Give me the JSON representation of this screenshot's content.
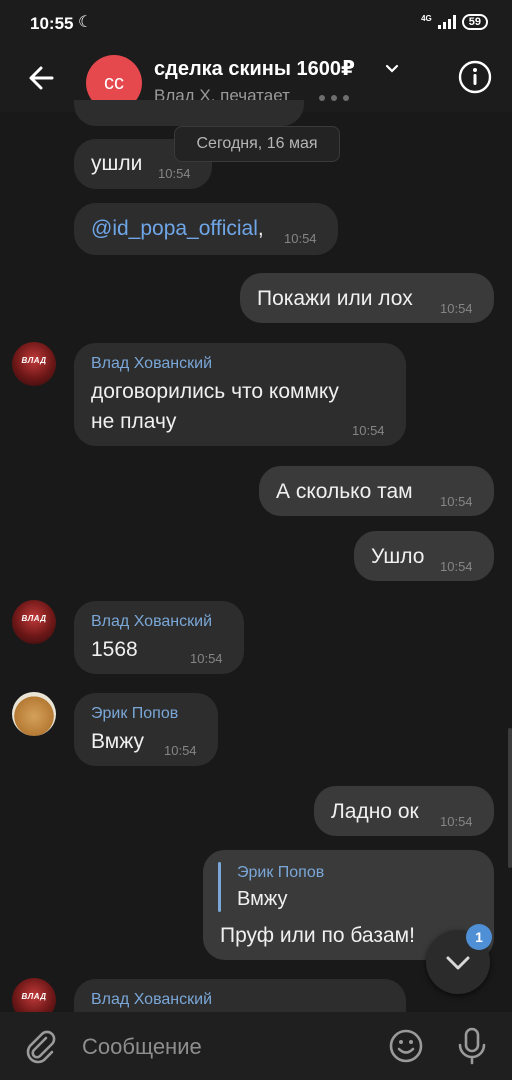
{
  "status_bar": {
    "time": "10:55",
    "network": "4G",
    "battery": "59"
  },
  "header": {
    "avatar_initials": "сс",
    "title": "сделка скины 1600₽",
    "subtitle": "Влад Х. печатает"
  },
  "date_separator": "Сегодня, 16 мая",
  "messages": [
    {
      "text": "ушли",
      "time": "10:54"
    },
    {
      "text": "@id_popa_official",
      "suffix": ",",
      "time": "10:54"
    },
    {
      "text": "Покажи или лох",
      "time": "10:54"
    },
    {
      "sender": "Влад Хованский",
      "line1": "договорились что коммку",
      "line2": "не плачу",
      "time": "10:54"
    },
    {
      "text": "А сколько там",
      "time": "10:54"
    },
    {
      "text": "Ушло",
      "time": "10:54"
    },
    {
      "sender": "Влад Хованский",
      "text": "1568",
      "time": "10:54"
    },
    {
      "sender": "Эрик Попов",
      "text": "Вмжу",
      "time": "10:54"
    },
    {
      "text": "Ладно ок",
      "time": "10:54"
    },
    {
      "reply_sender": "Эрик Попов",
      "reply_text": "Вмжу",
      "text": "Пруф или по базам!"
    },
    {
      "sender": "Влад Хованский"
    }
  ],
  "avatar_text": "ВЛАД",
  "scroll_badge": "1",
  "composer": {
    "placeholder": "Сообщение"
  },
  "colors": {
    "background": "#191919",
    "accent": "#7aa7d8",
    "avatar_red": "#e5484d",
    "badge": "#4f8fd6"
  }
}
